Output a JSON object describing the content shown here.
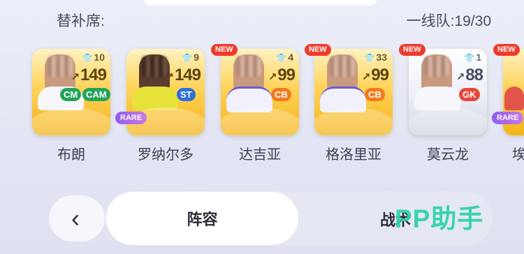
{
  "header": {
    "bench_title": "替补席:",
    "squad_count": "一线队:19/30"
  },
  "players": [
    {
      "name": "布朗",
      "jersey": "10",
      "rating": "149",
      "positions": [
        "CM",
        "CAM"
      ],
      "new": false,
      "rare": false,
      "card": "gold"
    },
    {
      "name": "罗纳尔多",
      "jersey": "9",
      "rating": "149",
      "positions": [
        "ST"
      ],
      "new": false,
      "rare": true,
      "card": "gold"
    },
    {
      "name": "达吉亚",
      "jersey": "4",
      "rating": "99",
      "positions": [
        "CB"
      ],
      "new": true,
      "rare": false,
      "card": "gold"
    },
    {
      "name": "格洛里亚",
      "jersey": "33",
      "rating": "99",
      "positions": [
        "CB"
      ],
      "new": true,
      "rare": false,
      "card": "gold"
    },
    {
      "name": "莫云龙",
      "jersey": "1",
      "rating": "88",
      "positions": [
        "GK"
      ],
      "new": true,
      "rare": false,
      "card": "silver"
    },
    {
      "name": "埃",
      "jersey": "",
      "rating": "",
      "positions": [],
      "new": true,
      "rare": true,
      "card": "gold"
    }
  ],
  "badges": {
    "new": "NEW",
    "rare": "RARE"
  },
  "tabs": {
    "active": "阵容",
    "second": "战术"
  },
  "watermark": "PP助手",
  "colors": {
    "position_green": "#23a35a",
    "position_orange": "#f07a1c",
    "position_blue": "#2f6fd8",
    "position_red": "#e8473a",
    "new_badge": "#ef3b2d",
    "watermark": "#2fd3a5"
  },
  "icons": {
    "back": "chevron-left-icon",
    "jersey": "shirt-icon",
    "trend": "trend-arrow-icon"
  }
}
